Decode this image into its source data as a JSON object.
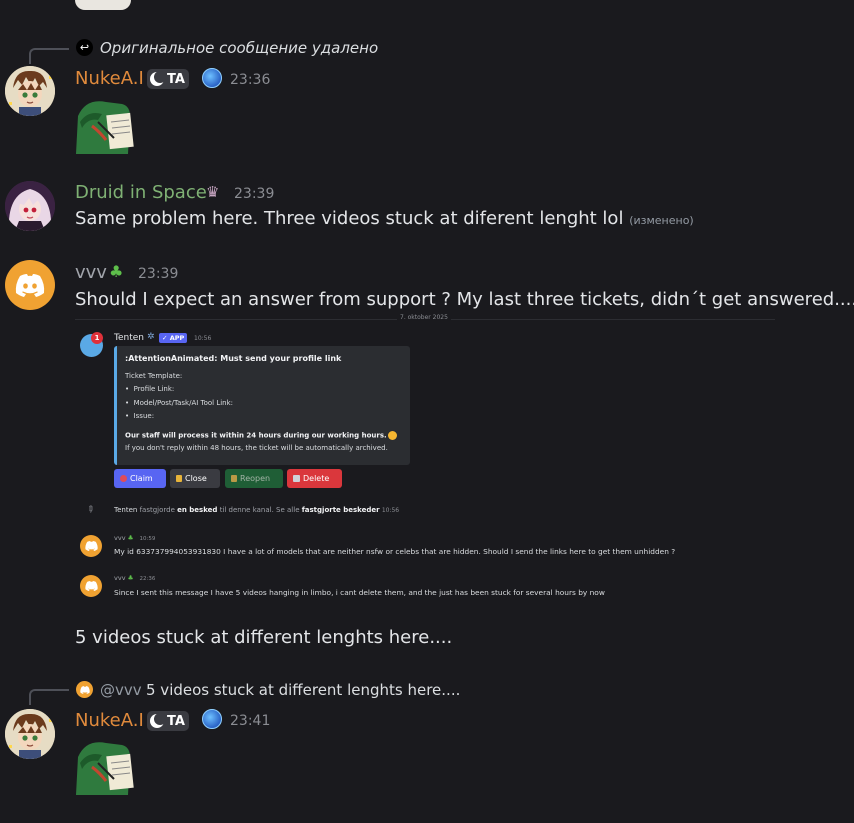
{
  "messages": {
    "m1": {
      "reply_text": "Оригинальное сообщение удалено",
      "author": "NukeA.I",
      "tag": "TA",
      "time": "23:36",
      "name_color": "#e08a3c"
    },
    "m2": {
      "author": "Druid in Space",
      "time": "23:39",
      "text": "Same problem here. Three videos stuck at diferent lenght lol",
      "edited": "(изменено)",
      "name_color": "#7fb174"
    },
    "m3": {
      "author": "vvv",
      "time": "23:39",
      "text": "Should I expect an answer from support ? My last three tickets, didn´t get answered....",
      "name_color": "#a1a4ab"
    },
    "m4": {
      "text": "5 videos stuck at different lenghts here...."
    },
    "m5": {
      "reply_mention": "@vvv",
      "reply_text": "5 videos stuck at different lenghts here....",
      "author": "NukeA.I",
      "tag": "TA",
      "time": "23:41",
      "name_color": "#e08a3c"
    }
  },
  "embedded_screenshot": {
    "date_divider": "7. oktober 2025",
    "bot": {
      "name": "Tenten",
      "app_badge": "✓ APP",
      "time": "10:56",
      "notif_count": "1",
      "embed_title": ":AttentionAnimated: Must send your profile link",
      "template_label": "Ticket Template:",
      "bullets": [
        "Profile Link:",
        "Model/Post/Task/AI Tool Link:",
        "Issue:"
      ],
      "bold_note": "Our staff will process it within 24 hours during our working hours.",
      "note": "If you don't reply within 48 hours, the ticket will be automatically archived.",
      "buttons": {
        "claim": "Claim",
        "close": "Close",
        "reopen": "Reopen",
        "delete": "Delete"
      }
    },
    "pin_notice": {
      "actor": "Tenten",
      "pre": "fastgjorde",
      "bold1": "en besked",
      "mid": "til denne kanal. Se alle",
      "bold2": "fastgjorte beskeder",
      "time": "10:56"
    },
    "msg_a": {
      "author": "vvv",
      "time": "10:59",
      "text": "My id 633737994053931830 I have a lot of models that are neither nsfw or celebs that are hidden. Should I send the links here to get them unhidden ?"
    },
    "msg_b": {
      "author": "vvv",
      "time": "22:36",
      "text": "Since I sent this message I have 5 videos hanging in limbo, i cant delete them, and the just has been stuck for several hours by now"
    }
  },
  "colors": {
    "background": "#1a1a1e",
    "blurple": "#5865f2",
    "discord_orange": "#f0a232",
    "green_btn": "#248046",
    "red_btn": "#da373c"
  }
}
